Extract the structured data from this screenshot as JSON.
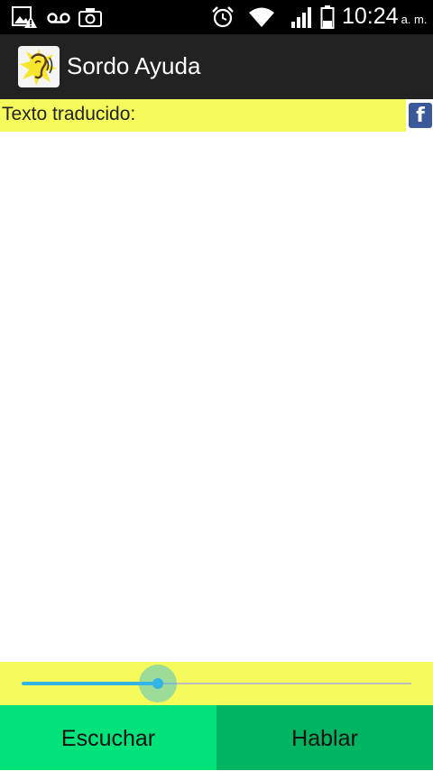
{
  "status_bar": {
    "icons": [
      "image-warning-icon",
      "voicemail-icon",
      "camera-icon",
      "alarm-icon",
      "wifi-icon",
      "signal-icon",
      "battery-icon"
    ],
    "time": "10:24",
    "ampm": "a. m."
  },
  "app": {
    "title": "Sordo Ayuda",
    "icon": "ear-sound-icon"
  },
  "translated": {
    "label": "Texto traducido:",
    "text": ""
  },
  "facebook": {
    "glyph": "f",
    "icon": "facebook-icon"
  },
  "slider": {
    "value_fraction": 0.35
  },
  "buttons": {
    "listen_label": "Escuchar",
    "speak_label": "Hablar"
  },
  "colors": {
    "accent_yellow": "#f4fb5a",
    "listen_green": "#00e37a",
    "speak_green": "#00b561",
    "slider_blue": "#33b5e5",
    "facebook_blue": "#3b5998"
  }
}
